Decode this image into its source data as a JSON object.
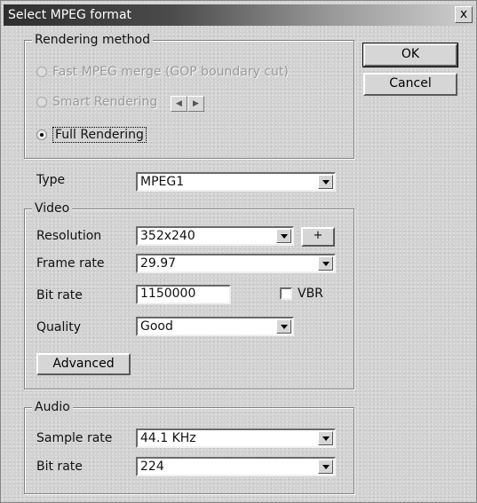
{
  "window": {
    "title": "Select MPEG format",
    "close_glyph": "x"
  },
  "buttons": {
    "ok": "OK",
    "cancel": "Cancel",
    "advanced": "Advanced",
    "resolution_plus": "+"
  },
  "rendering_method": {
    "label": "Rendering method",
    "options": [
      {
        "label": "Fast MPEG merge (GOP boundary cut)",
        "selected": false,
        "enabled": false
      },
      {
        "label": "Smart Rendering",
        "selected": false,
        "enabled": false
      },
      {
        "label": "Full Rendering",
        "selected": true,
        "enabled": true
      }
    ],
    "spin_left_glyph": "◀",
    "spin_right_glyph": "▶"
  },
  "type": {
    "label": "Type",
    "value": "MPEG1"
  },
  "video": {
    "label": "Video",
    "resolution_label": "Resolution",
    "resolution_value": "352x240",
    "frame_rate_label": "Frame rate",
    "frame_rate_value": "29.97",
    "bit_rate_label": "Bit rate",
    "bit_rate_value": "1150000",
    "vbr_label": "VBR",
    "vbr_checked": false,
    "quality_label": "Quality",
    "quality_value": "Good"
  },
  "audio": {
    "label": "Audio",
    "sample_rate_label": "Sample rate",
    "sample_rate_value": "44.1 KHz",
    "bit_rate_label": "Bit rate",
    "bit_rate_value": "224"
  },
  "icons": {
    "close": "close-icon",
    "dropdown": "chevron-down-icon",
    "spin_left": "arrow-left-icon",
    "spin_right": "arrow-right-icon"
  }
}
